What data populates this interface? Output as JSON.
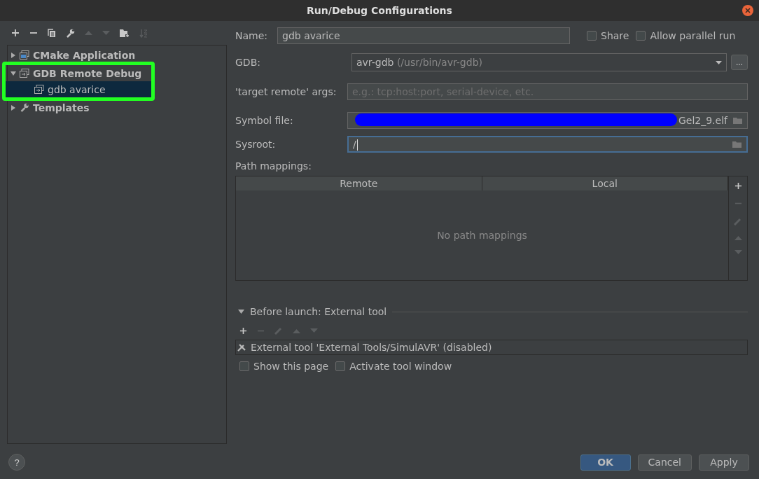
{
  "window": {
    "title": "Run/Debug Configurations"
  },
  "tree": [
    {
      "label": "CMake Application",
      "expanded": false,
      "selected": false,
      "kind": "app"
    },
    {
      "label": "GDB Remote Debug",
      "expanded": true,
      "selected": false,
      "kind": "remote",
      "highlighted": true,
      "children": [
        {
          "label": "gdb avarice",
          "selected": true,
          "kind": "remote"
        }
      ]
    },
    {
      "label": "Templates",
      "expanded": false,
      "selected": false,
      "kind": "wrench"
    }
  ],
  "name": {
    "label": "Name:",
    "value": "gdb avarice"
  },
  "options": [
    {
      "label": "Share",
      "checked": false
    },
    {
      "label": "Allow parallel run",
      "checked": false
    }
  ],
  "gdb": {
    "label": "GDB:",
    "value": "avr-gdb",
    "hint": "(/usr/bin/avr-gdb)",
    "browse": "..."
  },
  "target_remote": {
    "label": "'target remote' args:",
    "placeholder": "e.g.: tcp:host:port, serial-device, etc."
  },
  "symbol_file": {
    "label": "Symbol file:",
    "value": "Gel2_9.elf",
    "redacted": true
  },
  "sysroot": {
    "label": "Sysroot:",
    "value": "/",
    "focused": true
  },
  "path_mappings": {
    "label": "Path mappings:",
    "columns": [
      "Remote",
      "Local"
    ],
    "empty_text": "No path mappings"
  },
  "before_launch": {
    "title": "Before launch: External tool",
    "expanded": true,
    "items": [
      "External tool 'External Tools/SimulAVR' (disabled)"
    ]
  },
  "launch_options": [
    {
      "label": "Show this page",
      "checked": false
    },
    {
      "label": "Activate tool window",
      "checked": false
    }
  ],
  "footer": {
    "help": "?",
    "buttons": [
      {
        "label": "OK",
        "default": true
      },
      {
        "label": "Cancel",
        "default": false
      },
      {
        "label": "Apply",
        "default": false
      }
    ]
  }
}
